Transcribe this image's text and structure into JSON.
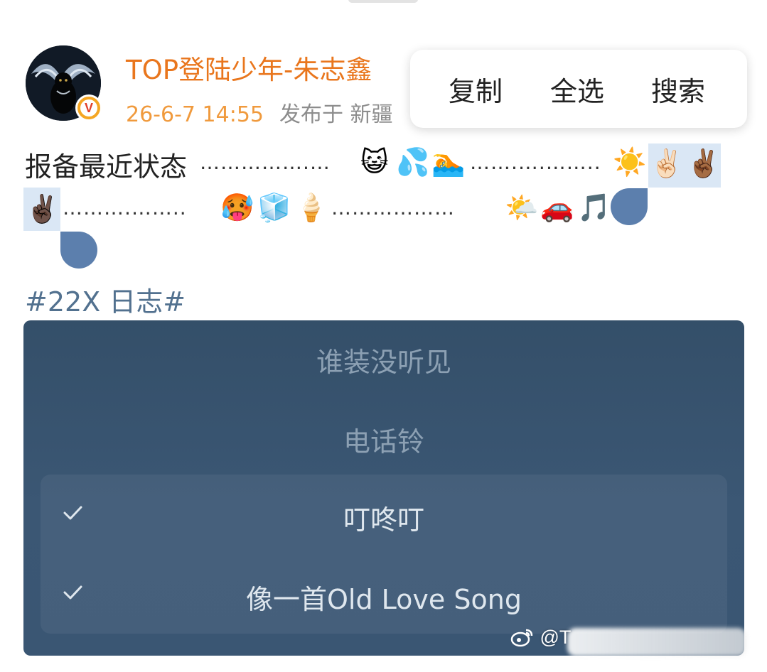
{
  "post": {
    "username": "TOP登陆少年-朱志鑫",
    "timestamp": "26-6-7 14:55",
    "location": "发布于 新疆",
    "text_line1": "报备最近状态",
    "dots_a": "…………….…",
    "dots_b": "…….….……..",
    "dots_c": "……….……..",
    "dots_d": "………………",
    "hashtag": "#22X 日志#",
    "emojis": {
      "cat": "😺",
      "sweat": "💦",
      "swim": "🏊",
      "sun": "☀️",
      "peace_light": "✌🏻",
      "peace_medium": "✌🏾",
      "peace_dark": "✌🏿",
      "hot": "🥵",
      "ice": "🧊",
      "icecream": "🍦",
      "sun_cloud": "🌤️",
      "car": "🚗",
      "music": "🎵"
    },
    "icons": {
      "avatar": "avatar",
      "verified": "verified-badge-icon"
    },
    "verified_letter": "V"
  },
  "context_menu": {
    "copy": "复制",
    "select_all": "全选",
    "search": "搜索"
  },
  "image": {
    "items": [
      {
        "label": "谁装没听见",
        "checked": false
      },
      {
        "label": "电话铃",
        "checked": false
      },
      {
        "label": "叮咚叮",
        "checked": true
      },
      {
        "label": "像一首Old Love Song",
        "checked": true
      }
    ],
    "watermark": "@T"
  },
  "colors": {
    "username": "#e9761d",
    "timestamp": "#f09a3d",
    "hashtag": "#52718f",
    "selection": "#dae7f5",
    "selection_handle": "#5c7fad",
    "image_bg": "#3a5673"
  }
}
